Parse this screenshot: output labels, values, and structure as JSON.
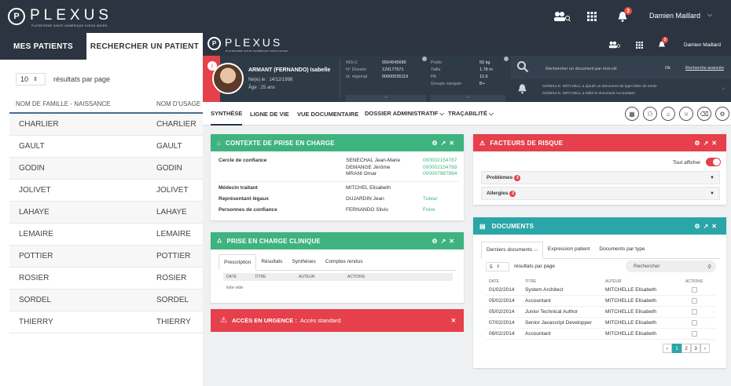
{
  "app": {
    "brand": "PLEXUS",
    "subtitle": "PLATEFORME SANTÉ NUMÉRIQUE OCÉAN INDIEN",
    "user": "Damien Maillard"
  },
  "topbar": {
    "notif_count": "3"
  },
  "left": {
    "tab_active": "MES PATIENTS",
    "tab_other": "RECHERCHER UN PATIENT",
    "page_size": "10",
    "page_size_label": "résultats par page",
    "col1": "NOM DE FAMILLE - NAISSANCE",
    "col2": "NOM D'USAGE",
    "rows": [
      {
        "a": "CHARLIER",
        "b": "CHARLIER"
      },
      {
        "a": "GAULT",
        "b": "GAULT"
      },
      {
        "a": "GODIN",
        "b": "GODIN"
      },
      {
        "a": "JOLIVET",
        "b": "JOLIVET"
      },
      {
        "a": "LAHAYE",
        "b": "LAHAYE"
      },
      {
        "a": "LEMAIRE",
        "b": "LEMAIRE"
      },
      {
        "a": "POTTIER",
        "b": "POTTIER"
      },
      {
        "a": "ROSIER",
        "b": "ROSIER"
      },
      {
        "a": "SORDEL",
        "b": "SORDEL"
      },
      {
        "a": "THIERRY",
        "b": "THIERRY"
      }
    ]
  },
  "patient": {
    "name": "ARMANT (FERNANDO) Isabelle",
    "born": "Né(e) le : 14/12/1998",
    "age": "Âge : 25 ans",
    "ids": [
      [
        "INS-C",
        "5564545689"
      ],
      [
        "N° Dossier",
        "129177571"
      ],
      [
        "Id. régional",
        "00000035119"
      ]
    ],
    "bio": [
      [
        "Poids",
        "55 kg"
      ],
      [
        "Taille",
        "1.78 m"
      ],
      [
        "PA",
        "12.6"
      ],
      [
        "Groupe sanguin",
        "B+"
      ]
    ],
    "search_placeholder": "Rechercher un document par mot-clé",
    "search_ok": "Ok",
    "advanced": "Recherche avancée",
    "feed": [
      "01/05/14 E. MITCHELL a ajouté un document de type lettre de sortie",
      "01/05/14 E. MITCHELL a édité le document Accountant"
    ]
  },
  "nav": {
    "items": [
      "SYNTHÈSE",
      "LIGNE DE VIE",
      "VUE DOCUMENTAIRE",
      "DOSSIER ADMINISTRATIF ⌵",
      "TRAÇABILITÉ ⌵"
    ]
  },
  "contexte": {
    "title": "CONTEXTE DE PRISE EN CHARGE",
    "cercle_label": "Cercle de confiance",
    "cercle": [
      [
        "SENECHAL Jean-Marie",
        "000002154787"
      ],
      [
        "DEMANGE Jérôme",
        "000002154789"
      ],
      [
        "MRANI Omar",
        "000007987894"
      ]
    ],
    "medecin_label": "Médecin traitant",
    "medecin": "MITCHEL Elisabeth",
    "rep_label": "Représentant légaux",
    "rep": "DUJARDIN Jean",
    "rep_role": "Tuteur",
    "pers_label": "Personnes de confiance",
    "pers": "FERNANDO Silvio",
    "pers_role": "Frère"
  },
  "clinique": {
    "title": "PRISE EN CHARGE CLINIQUE",
    "tabs": [
      "Prescription",
      "Résultats",
      "Synthèses",
      "Comptes rendus"
    ],
    "cols": [
      "DATE",
      "TITRE",
      "AUTEUR",
      "ACTIONS"
    ],
    "empty": "liste vide"
  },
  "urgence": {
    "title": "ACCÈS EN URGENCE :",
    "value": "Accès standard"
  },
  "risque": {
    "title": "FACTEURS DE RISQUE",
    "toggle": "Tout afficher",
    "problemes": "Problèmes",
    "prob_count": "3",
    "allergies": "Allergies",
    "all_count": "3"
  },
  "documents": {
    "title": "DOCUMENTS",
    "tabs": [
      "Derniers documents ⌵",
      "Expression patient",
      "Documents par type"
    ],
    "page_size": "5",
    "page_size_label": "résultats par page",
    "search": "Rechercher",
    "cols": [
      "DATE",
      "TITRE",
      "AUTEUR",
      "ACTIONS"
    ],
    "rows": [
      [
        "01/02/2014",
        "System Architect",
        "MITCHELLE Elisabeth"
      ],
      [
        "05/02/2014",
        "Accountant",
        "MITCHELLE Elisabeth"
      ],
      [
        "05/02/2014",
        "Junior Technical Author",
        "MITCHELLE Elisabeth"
      ],
      [
        "07/02/2014",
        "Senior Javascript Developper",
        "MITCHELLE Elisabeth"
      ],
      [
        "08/02/2014",
        "Accountant",
        "MITCHELLE Elisabeth"
      ]
    ],
    "pages": [
      "1",
      "2",
      "3"
    ]
  },
  "colors": {
    "green": "#3fb37f",
    "red": "#e5404b",
    "teal": "#2aa6a8",
    "dark": "#2b3440"
  }
}
